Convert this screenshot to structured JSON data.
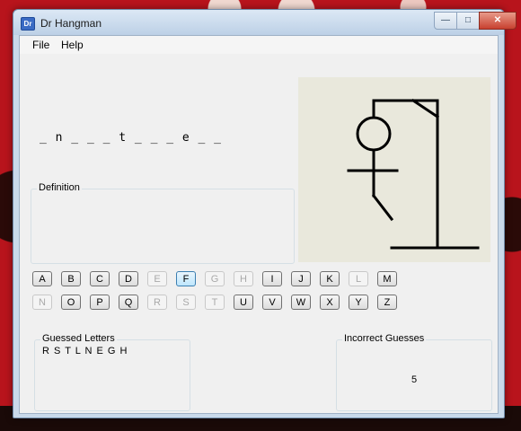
{
  "window": {
    "title": "Dr Hangman",
    "icon_label": "Dr",
    "icon": "app-icon"
  },
  "titlebar_buttons": {
    "minimize": "—",
    "maximize": "□",
    "close": "✕"
  },
  "menu": {
    "file": "File",
    "help": "Help"
  },
  "word_display": "_ n _ _ _ t _ _ _ e _ _",
  "definition": {
    "label": "Definition",
    "text": ""
  },
  "letters_row1": [
    {
      "letter": "A",
      "enabled": true
    },
    {
      "letter": "B",
      "enabled": true
    },
    {
      "letter": "C",
      "enabled": true
    },
    {
      "letter": "D",
      "enabled": true
    },
    {
      "letter": "E",
      "enabled": false
    },
    {
      "letter": "F",
      "enabled": true,
      "focused": true
    },
    {
      "letter": "G",
      "enabled": false
    },
    {
      "letter": "H",
      "enabled": false
    },
    {
      "letter": "I",
      "enabled": true
    },
    {
      "letter": "J",
      "enabled": true
    },
    {
      "letter": "K",
      "enabled": true
    },
    {
      "letter": "L",
      "enabled": false
    },
    {
      "letter": "M",
      "enabled": true
    }
  ],
  "letters_row2": [
    {
      "letter": "N",
      "enabled": false
    },
    {
      "letter": "O",
      "enabled": true
    },
    {
      "letter": "P",
      "enabled": true
    },
    {
      "letter": "Q",
      "enabled": true
    },
    {
      "letter": "R",
      "enabled": false
    },
    {
      "letter": "S",
      "enabled": false
    },
    {
      "letter": "T",
      "enabled": false
    },
    {
      "letter": "U",
      "enabled": true
    },
    {
      "letter": "V",
      "enabled": true
    },
    {
      "letter": "W",
      "enabled": true
    },
    {
      "letter": "X",
      "enabled": true
    },
    {
      "letter": "Y",
      "enabled": true
    },
    {
      "letter": "Z",
      "enabled": true
    }
  ],
  "guessed": {
    "label": "Guessed Letters",
    "value": "R S T L N E G H"
  },
  "incorrect": {
    "label": "Incorrect Guesses",
    "value": "5"
  },
  "colors": {
    "gallows_bg": "#e9e8dc",
    "window_frame": "#c9d9ea",
    "wallpaper": "#b8141c"
  }
}
